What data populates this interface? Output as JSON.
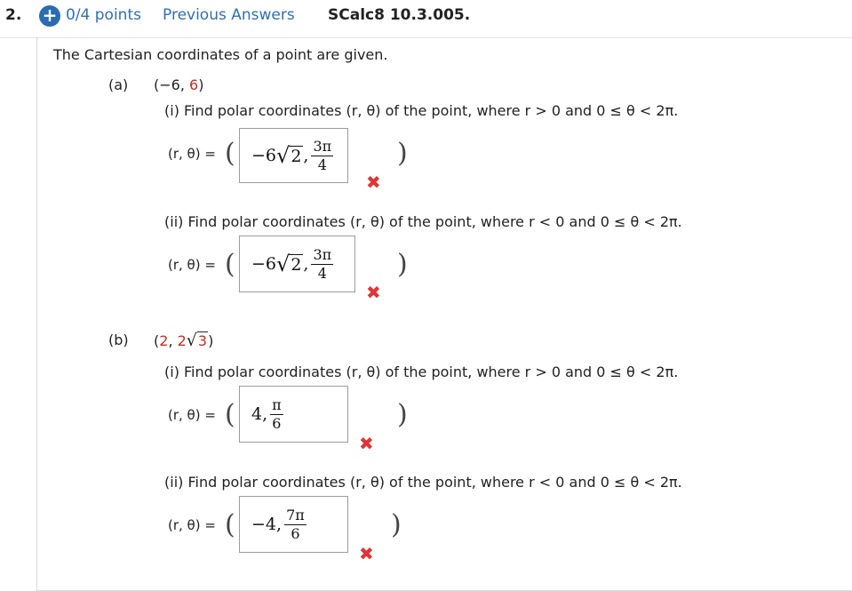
{
  "header": {
    "question_number": "2.",
    "points": "0/4 points",
    "previous_answers": "Previous Answers",
    "code": "SCalc8 10.3.005."
  },
  "intro": "The Cartesian coordinates of a point are given.",
  "parts": [
    {
      "label": "(a)",
      "point_open": "(",
      "point_x": "−6",
      "point_sep": ", ",
      "point_y": "6",
      "point_close": ")",
      "subparts": [
        {
          "question": "(i) Find polar coordinates (r, θ) of the point, where r > 0 and 0 ≤ θ < 2π.",
          "eq_label": "(r, θ) =",
          "answer": {
            "prefix": "−6",
            "radicand": "2",
            "sep": ",",
            "frac_num": "3π",
            "frac_den": "4"
          },
          "status": "incorrect"
        },
        {
          "question": "(ii) Find polar coordinates (r, θ) of the point, where r < 0 and 0 ≤ θ < 2π.",
          "eq_label": "(r, θ) =",
          "answer": {
            "prefix": "−6",
            "radicand": "2",
            "sep": ",",
            "frac_num": "3π",
            "frac_den": "4"
          },
          "status": "incorrect"
        }
      ]
    },
    {
      "label": "(b)",
      "point_open": "(",
      "point_x": "2",
      "point_sep": ", ",
      "point_y_prefix": "2",
      "point_y_radicand": "3",
      "point_close": ")",
      "subparts": [
        {
          "question": "(i) Find polar coordinates (r, θ) of the point, where r > 0 and 0 ≤ θ < 2π.",
          "eq_label": "(r, θ) =",
          "answer": {
            "prefix": "4,",
            "frac_num": "π",
            "frac_den": "6"
          },
          "status": "incorrect"
        },
        {
          "question": "(ii) Find polar coordinates (r, θ) of the point, where r < 0 and 0 ≤ θ < 2π.",
          "eq_label": "(r, θ) =",
          "answer": {
            "prefix": "−4,",
            "frac_num": "7π",
            "frac_den": "6"
          },
          "status": "incorrect"
        }
      ]
    }
  ],
  "paren_open": "(",
  "paren_close": ")",
  "icons": {
    "add": "plus-circle-icon",
    "incorrect": "x-mark-icon"
  },
  "colors": {
    "link": "#2f6fb7",
    "incorrect": "#e03434",
    "highlight": "#d0291f",
    "add_button": "#2b6cb0"
  }
}
